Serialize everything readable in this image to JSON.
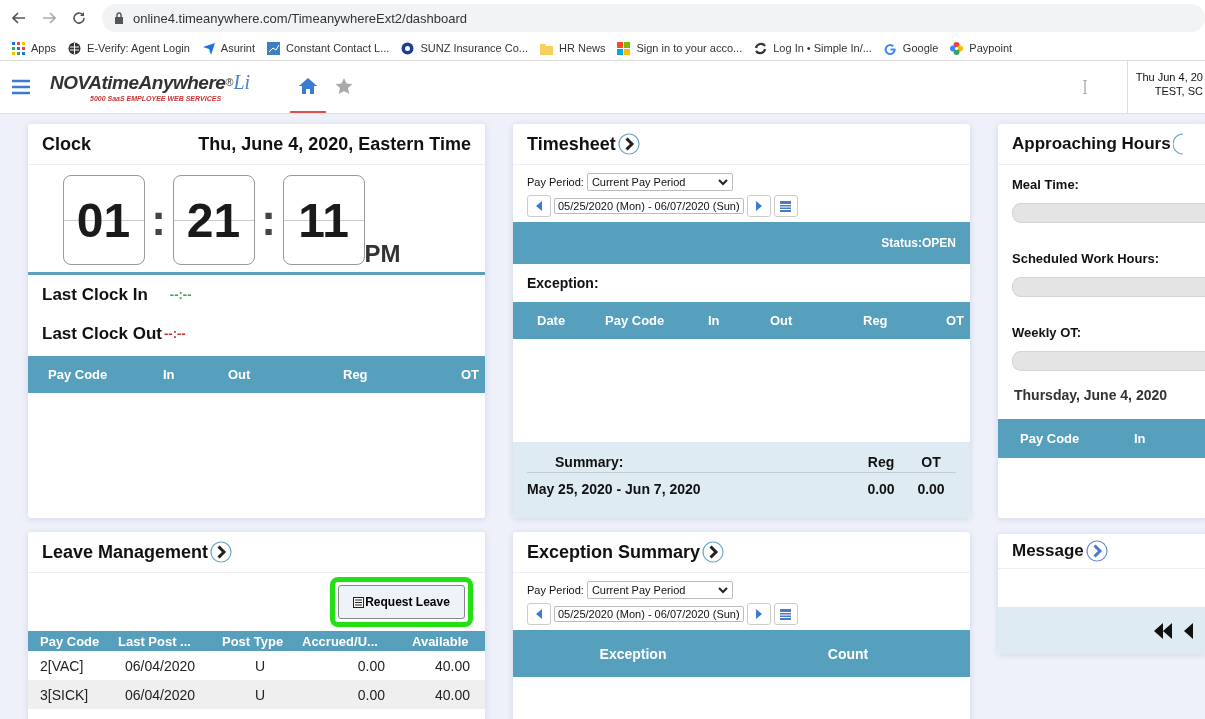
{
  "browser": {
    "url": "online4.timeanywhere.com/TimeanywhereExt2/dashboard",
    "bookmarks": [
      {
        "kind": "apps",
        "label": "Apps"
      },
      {
        "kind": "globe",
        "label": "E-Verify: Agent Login"
      },
      {
        "kind": "arrow",
        "label": "Asurint"
      },
      {
        "kind": "chart",
        "label": "Constant Contact  L..."
      },
      {
        "kind": "seal",
        "label": "SUNZ Insurance Co..."
      },
      {
        "kind": "folder",
        "label": "HR News"
      },
      {
        "kind": "windows",
        "label": "Sign in to your acco..."
      },
      {
        "kind": "sync",
        "label": "Log In • Simple In/..."
      },
      {
        "kind": "google",
        "label": "Google"
      },
      {
        "kind": "pinwheel",
        "label": "Paypoint"
      }
    ]
  },
  "app_header": {
    "logo_title": "NOVAtimeAnywhere",
    "logo_mark": "®",
    "logo_suffix": "Li",
    "logo_tagline": "5000 SaaS EMPLOYEE WEB SERVICES",
    "tabs": [
      {
        "kind": "home",
        "selected": true
      },
      {
        "kind": "star",
        "selected": false
      }
    ],
    "date": "Thu Jun 4, 20",
    "user": "TEST, SC"
  },
  "clock": {
    "title": "Clock",
    "date": "Thu, June 4, 2020, Eastern Time",
    "hours": "01",
    "minutes": "21",
    "seconds": "11",
    "separator_1": ":",
    "separator_2": ":",
    "ampm": "PM",
    "last_in": {
      "label": "Last Clock In",
      "value": "--:--"
    },
    "last_out": {
      "label": "Last Clock Out",
      "value": "--:--"
    },
    "columns": [
      "Pay Code",
      "In",
      "Out",
      "Reg",
      "OT"
    ]
  },
  "timesheet": {
    "title": "Timesheet",
    "pay_period_label": "Pay Period:",
    "pay_period": "Current Pay Period",
    "date_range": "05/25/2020 (Mon) - 06/07/2020 (Sun)",
    "status": "Status:OPEN",
    "exception_label": "Exception:",
    "columns": [
      "Date",
      "Pay Code",
      "In",
      "Out",
      "Reg",
      "OT"
    ],
    "summary": {
      "label": "Summary:",
      "reg_label": "Reg",
      "ot_label": "OT",
      "range": "May 25, 2020 - Jun 7, 2020",
      "reg": "0.00",
      "ot": "0.00"
    }
  },
  "approaching_hours": {
    "title": "Approaching Hours",
    "meters": [
      {
        "label": "Meal Time:",
        "level": 0
      },
      {
        "label": "Scheduled Work Hours:",
        "level": 0
      },
      {
        "label": "Weekly OT:",
        "level": 0
      }
    ],
    "date": "Thursday, June 4, 2020",
    "columns": [
      "Pay Code",
      "In"
    ]
  },
  "leave_management": {
    "title": "Leave Management",
    "request_button": {
      "label": "Request Leave",
      "highlighted": true
    },
    "columns": [
      "Pay Code",
      "Last Post ...",
      "Post Type",
      "Accrued/U...",
      "Available"
    ],
    "rows": [
      [
        "2[VAC]",
        "06/04/2020",
        "U",
        "0.00",
        "40.00"
      ],
      [
        "3[SICK]",
        "06/04/2020",
        "U",
        "0.00",
        "40.00"
      ]
    ]
  },
  "exception_summary": {
    "title": "Exception Summary",
    "pay_period_label": "Pay Period:",
    "pay_period": "Current Pay Period",
    "date_range": "05/25/2020 (Mon) - 06/07/2020 (Sun)",
    "columns": [
      "Exception",
      "Count"
    ]
  },
  "message": {
    "title": "Message"
  }
}
